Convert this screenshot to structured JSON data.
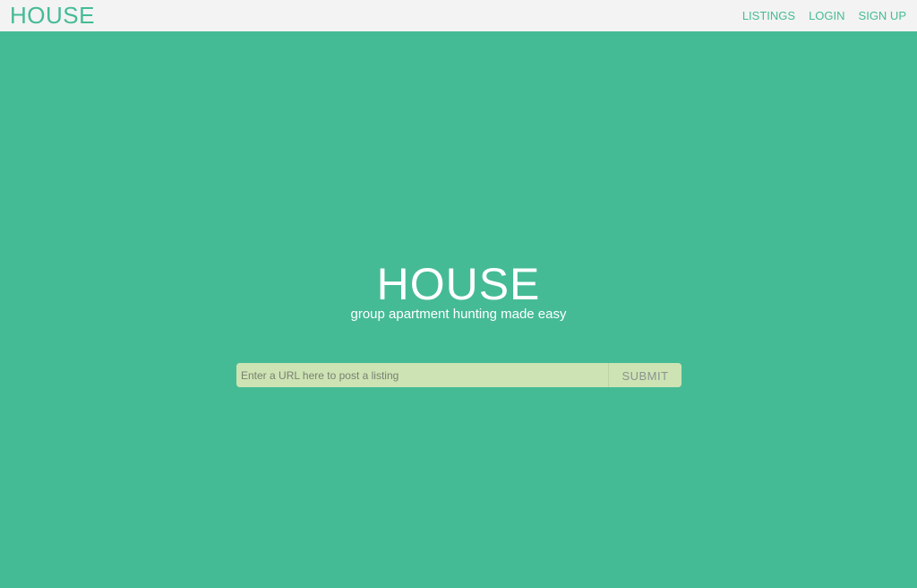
{
  "nav": {
    "brand": "HOUSE",
    "links": [
      {
        "label": "LISTINGS"
      },
      {
        "label": "LOGIN"
      },
      {
        "label": "SIGN UP"
      }
    ]
  },
  "hero": {
    "title": "HOUSE",
    "subtitle": "group apartment hunting made easy"
  },
  "post_form": {
    "url_placeholder": "Enter a URL here to post a listing",
    "url_value": "",
    "submit_label": "SUBMIT"
  },
  "colors": {
    "background": "#45bb95",
    "navbar": "#f3f3f3",
    "accent": "#45bb95",
    "input_bg": "#cde3b3"
  }
}
